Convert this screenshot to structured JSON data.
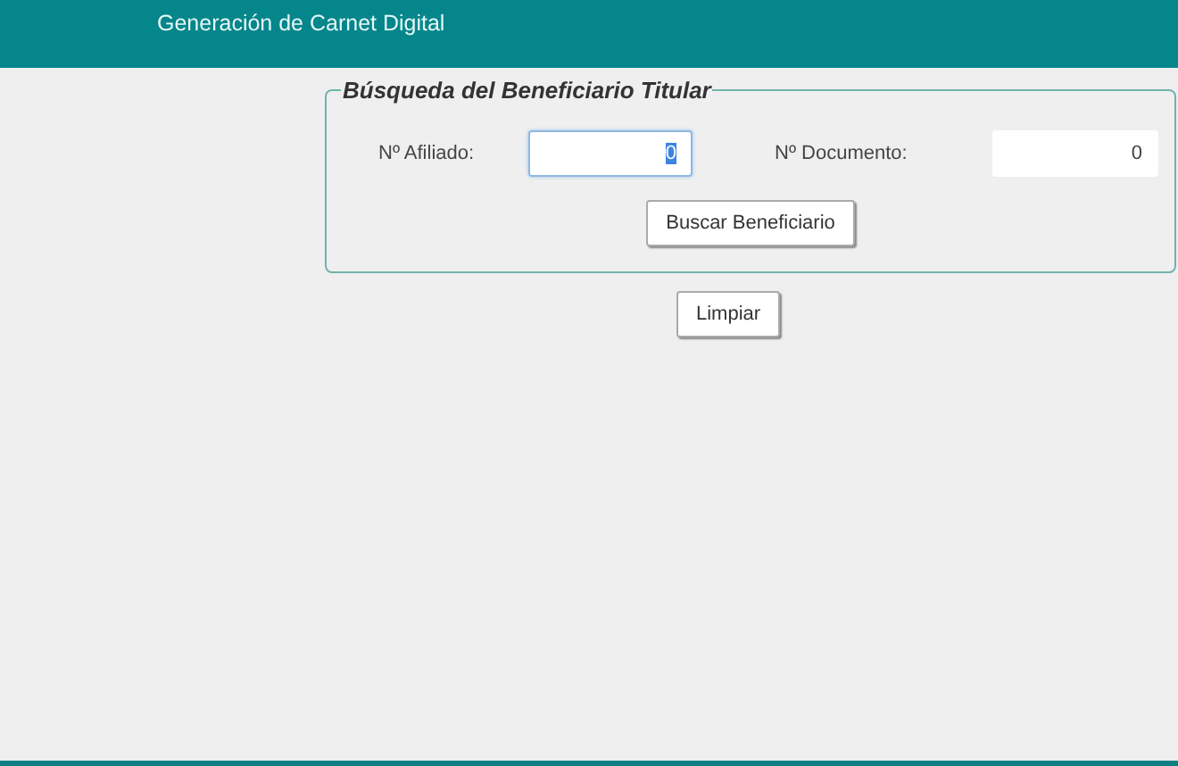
{
  "header": {
    "title": "Generación de Carnet Digital"
  },
  "search_panel": {
    "legend": "Búsqueda del Beneficiario Titular",
    "fields": [
      {
        "label": "Nº Afiliado:",
        "value": "0",
        "focused": true,
        "value_selected": true
      },
      {
        "label": "Nº Documento:",
        "value": "0",
        "focused": false,
        "value_selected": false
      }
    ],
    "search_button": "Buscar Beneficiario"
  },
  "clear_button": "Limpiar"
}
